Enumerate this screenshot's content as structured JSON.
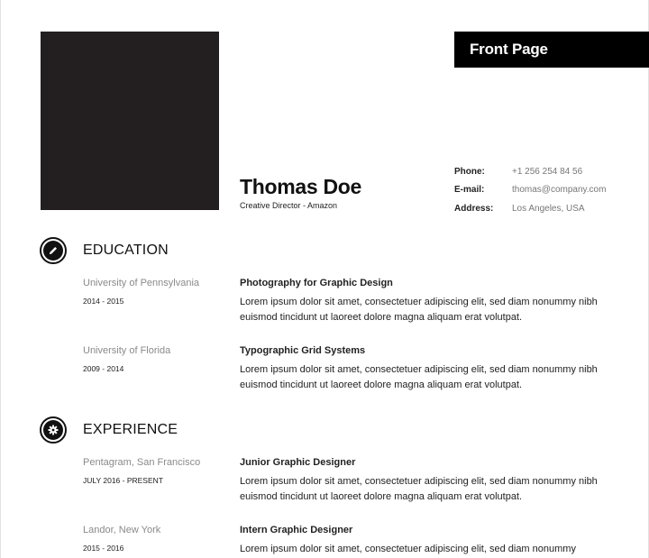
{
  "tab": {
    "label": "Front Page"
  },
  "profile": {
    "name": "Thomas Doe",
    "role": "Creative Director - Amazon"
  },
  "contact": [
    {
      "label": "Phone:",
      "value": "+1 256 254 84 56"
    },
    {
      "label": "E-mail:",
      "value": "thomas@company.com"
    },
    {
      "label": "Address:",
      "value": "Los Angeles, USA"
    }
  ],
  "education": {
    "title": "EDUCATION",
    "icon": "pencil-icon",
    "entries": [
      {
        "org": "University of Pennsylvania",
        "dates": "2014 - 2015",
        "title": "Photography for Graphic Design",
        "desc": "Lorem ipsum dolor sit amet, consectetuer adipiscing elit, sed diam nonummy nibh euismod tincidunt ut laoreet dolore magna aliquam erat volutpat."
      },
      {
        "org": "University of Florida",
        "dates": "2009 - 2014",
        "title": "Typographic Grid Systems",
        "desc": "Lorem ipsum dolor sit amet, consectetuer adipiscing elit, sed diam nonummy nibh euismod tincidunt ut laoreet dolore magna aliquam erat volutpat."
      }
    ]
  },
  "experience": {
    "title": "EXPERIENCE",
    "icon": "gear-icon",
    "entries": [
      {
        "org": "Pentagram, San Francisco",
        "dates": "JULY 2016 - PRESENT",
        "title": "Junior Graphic Designer",
        "desc": "Lorem ipsum dolor sit amet, consectetuer adipiscing elit, sed diam nonummy nibh euismod tincidunt ut laoreet dolore magna aliquam erat volutpat."
      },
      {
        "org": "Landor,  New York",
        "dates": "2015 - 2016",
        "title": "Intern Graphic Designer",
        "desc": "Lorem ipsum dolor sit amet, consectetuer adipiscing elit, sed diam nonummy"
      }
    ]
  }
}
